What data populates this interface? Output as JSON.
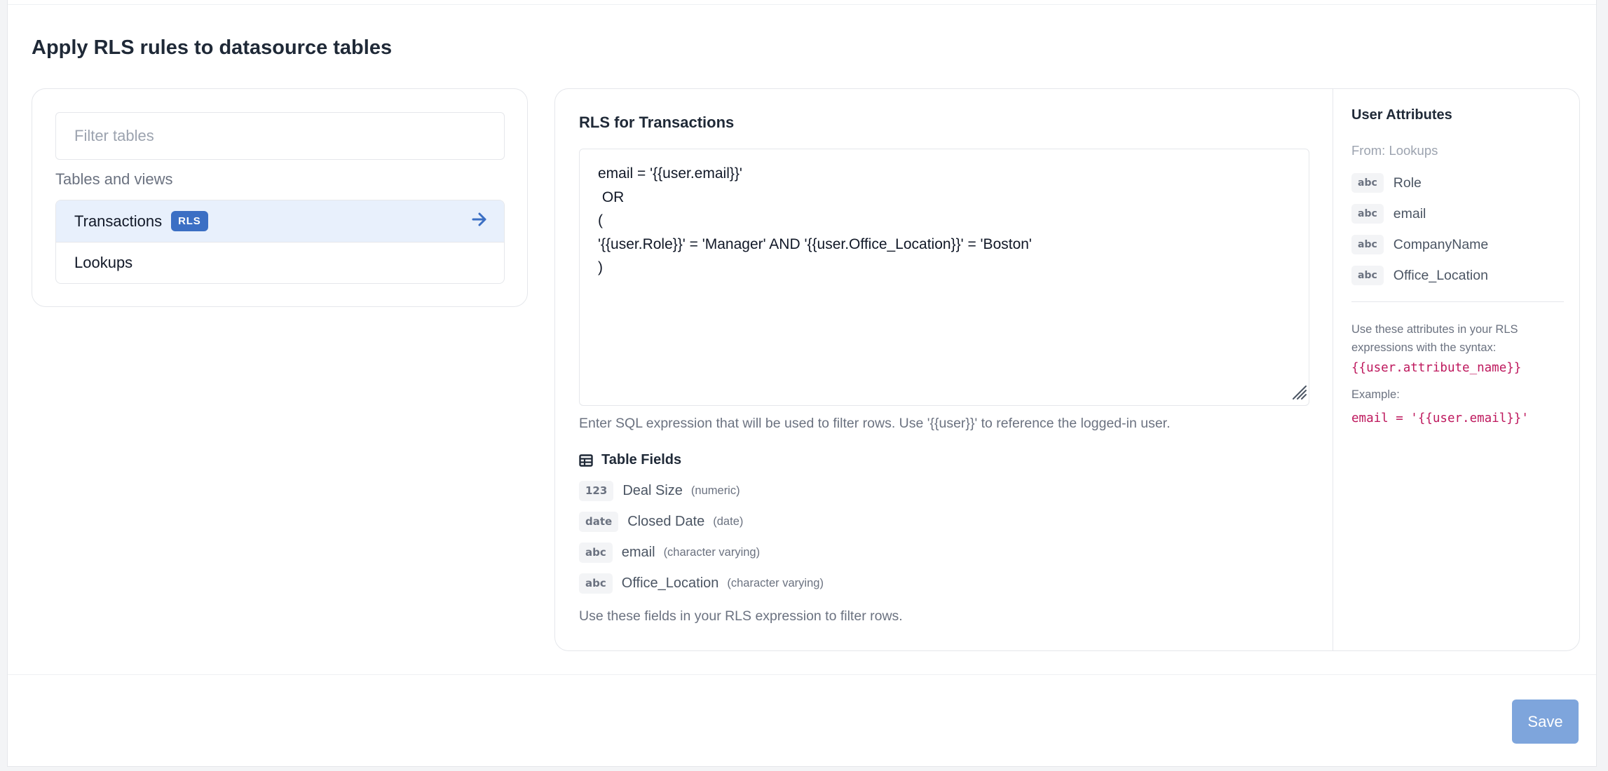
{
  "page": {
    "title": "Apply RLS rules to datasource tables"
  },
  "tables_panel": {
    "filter_placeholder": "Filter tables",
    "section_label": "Tables and views",
    "items": [
      {
        "label": "Transactions",
        "badge": "RLS",
        "selected": true
      },
      {
        "label": "Lookups",
        "badge": "",
        "selected": false
      }
    ]
  },
  "editor": {
    "title": "RLS for Transactions",
    "sql": "email = '{{user.email}}'\n OR\n(\n'{{user.Role}}' = 'Manager' AND '{{user.Office_Location}}' = 'Boston'\n)",
    "helper": "Enter SQL expression that will be used to filter rows. Use '{{user}}' to reference the logged-in user."
  },
  "table_fields": {
    "title": "Table Fields",
    "fields": [
      {
        "tag": "123",
        "name": "Deal Size",
        "type": "(numeric)"
      },
      {
        "tag": "date",
        "name": "Closed Date",
        "type": "(date)"
      },
      {
        "tag": "abc",
        "name": "email",
        "type": "(character varying)"
      },
      {
        "tag": "abc",
        "name": "Office_Location",
        "type": "(character varying)"
      }
    ],
    "footer": "Use these fields in your RLS expression to filter rows."
  },
  "user_attributes": {
    "title": "User Attributes",
    "source": "From: Lookups",
    "items": [
      {
        "tag": "abc",
        "name": "Role"
      },
      {
        "tag": "abc",
        "name": "email"
      },
      {
        "tag": "abc",
        "name": "CompanyName"
      },
      {
        "tag": "abc",
        "name": "Office_Location"
      }
    ],
    "help": "Use these attributes in your RLS expressions with the syntax:",
    "syntax": "{{user.attribute_name}}",
    "example_label": "Example:",
    "example": "email = '{{user.email}}'"
  },
  "footer": {
    "save_label": "Save"
  },
  "colors": {
    "accent": "#3b6fc4",
    "selected_bg": "#e8f0fc",
    "save_button": "#7ea5dc",
    "code": "#be185d"
  },
  "icons": {
    "selected_row": "arrow-right-icon",
    "fields_header": "table-grid-icon",
    "editor_corner": "resize-handle-icon"
  }
}
